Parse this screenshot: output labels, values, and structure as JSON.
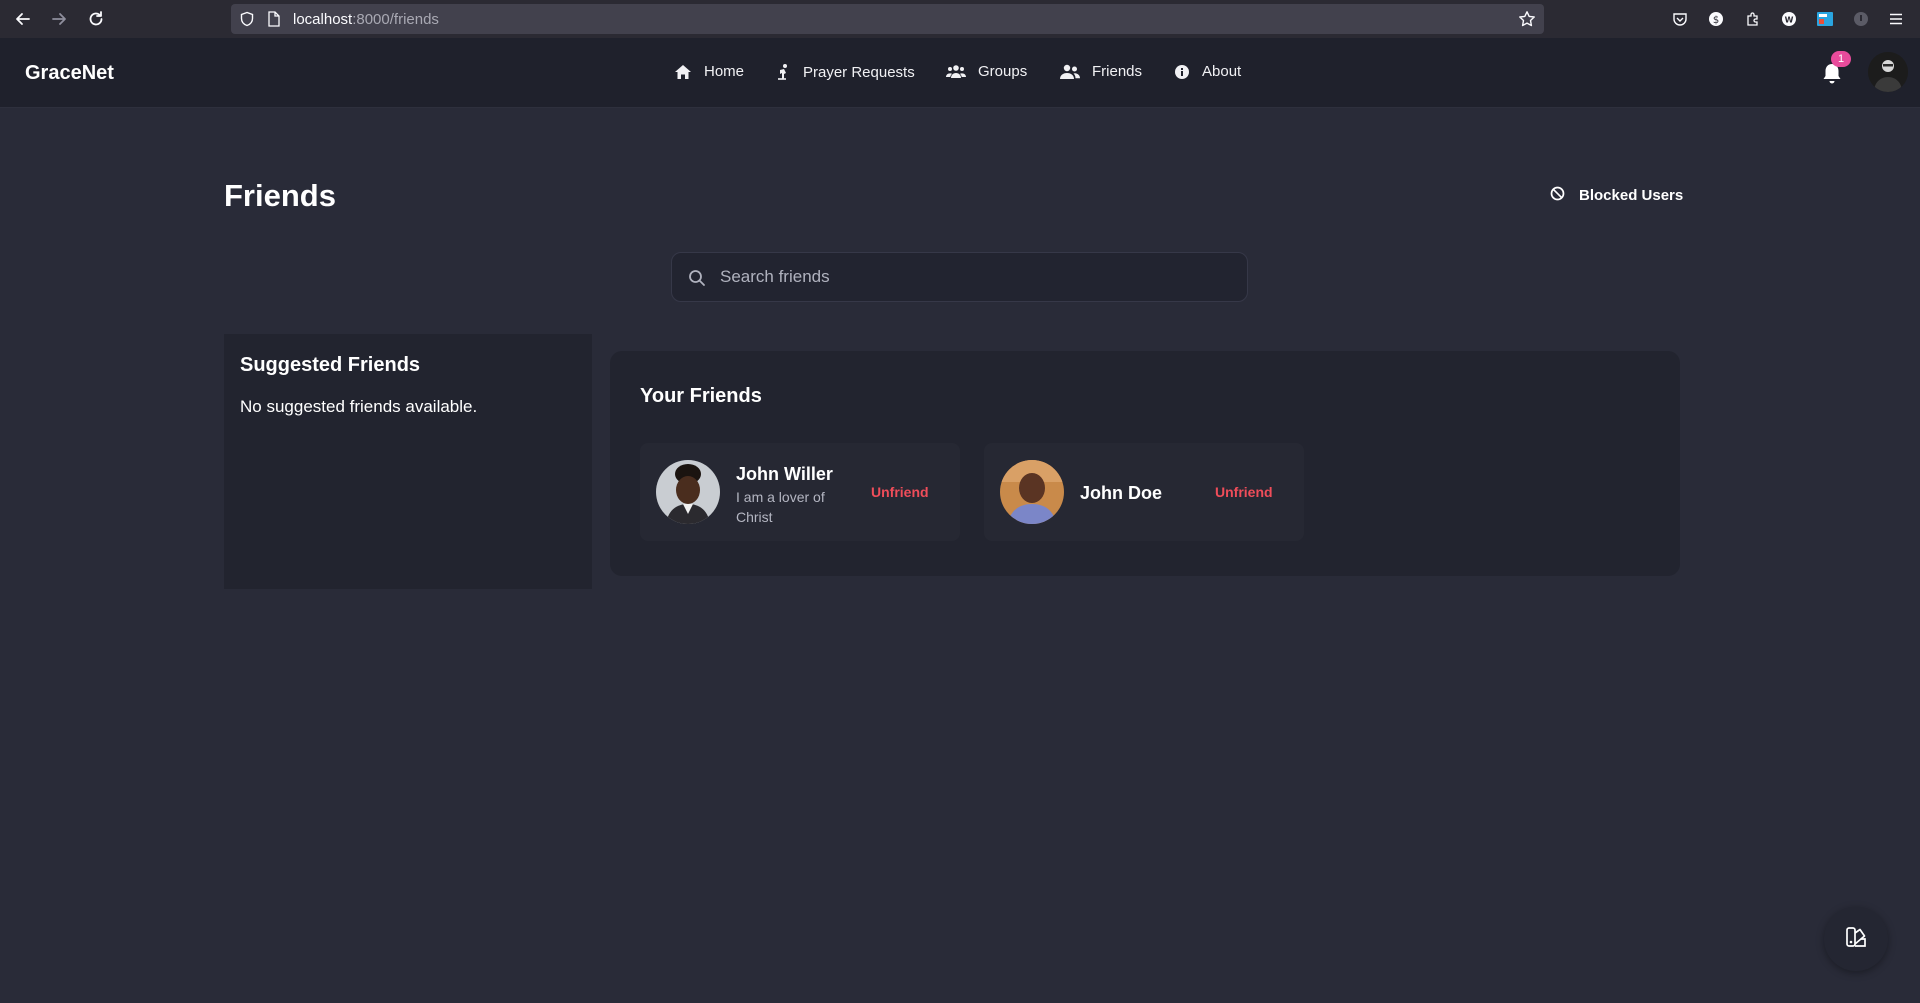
{
  "browser": {
    "url_host": "localhost",
    "url_path": ":8000/friends",
    "icons": [
      "back-icon",
      "forward-icon",
      "reload-icon",
      "shield-icon",
      "page-icon",
      "bookmark-star-icon",
      "pocket-icon",
      "extension-icon",
      "puzzle-icon",
      "wappalyzer-icon",
      "screen-icon",
      "info-icon",
      "menu-icon"
    ]
  },
  "nav": {
    "brand": "GraceNet",
    "items": [
      {
        "label": "Home",
        "icon": "home-icon"
      },
      {
        "label": "Prayer Requests",
        "icon": "praying-icon"
      },
      {
        "label": "Groups",
        "icon": "users-group-icon"
      },
      {
        "label": "Friends",
        "icon": "user-friends-icon"
      },
      {
        "label": "About",
        "icon": "info-circle-icon"
      }
    ],
    "notification_count": "1"
  },
  "page": {
    "title": "Friends",
    "blocked_users_label": "Blocked Users"
  },
  "search": {
    "placeholder": "Search friends"
  },
  "suggested": {
    "title": "Suggested Friends",
    "empty_text": "No suggested friends available."
  },
  "friends": {
    "title": "Your Friends",
    "list": [
      {
        "name": "John Willer",
        "bio": "I am a lover of Christ",
        "action": "Unfriend"
      },
      {
        "name": "John Doe",
        "bio": "",
        "action": "Unfriend"
      }
    ]
  },
  "colors": {
    "background": "#292b38",
    "navbar": "#1f212c",
    "card": "#22242f",
    "danger": "#ef4d5a",
    "badge": "#e84b9b"
  }
}
